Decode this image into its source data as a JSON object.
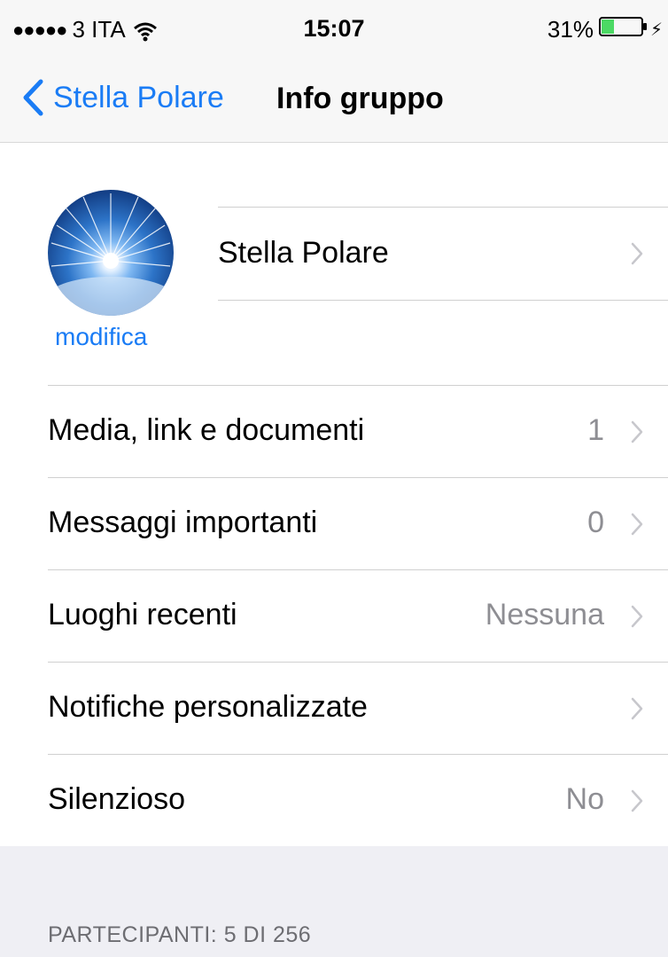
{
  "status_bar": {
    "carrier": "3 ITA",
    "signal_dots": "●●●●●",
    "time": "15:07",
    "battery_percent": "31%",
    "battery_level": 0.31,
    "icons": [
      "wifi-icon",
      "battery-icon",
      "charging-bolt-icon"
    ]
  },
  "nav": {
    "back_label": "Stella Polare",
    "title": "Info gruppo"
  },
  "group": {
    "name": "Stella Polare",
    "edit_label": "modifica"
  },
  "rows": [
    {
      "label": "Media, link e documenti",
      "value": "1"
    },
    {
      "label": "Messaggi importanti",
      "value": "0"
    },
    {
      "label": "Luoghi recenti",
      "value": "Nessuna"
    },
    {
      "label": "Notifiche personalizzate",
      "value": ""
    },
    {
      "label": "Silenzioso",
      "value": "No"
    }
  ],
  "participants_header": "PARTECIPANTI: 5 DI 256",
  "colors": {
    "accent": "#1a7cf5",
    "secondary_text": "#8e8e93",
    "background": "#efeff4",
    "battery_fill": "#4cd964"
  }
}
